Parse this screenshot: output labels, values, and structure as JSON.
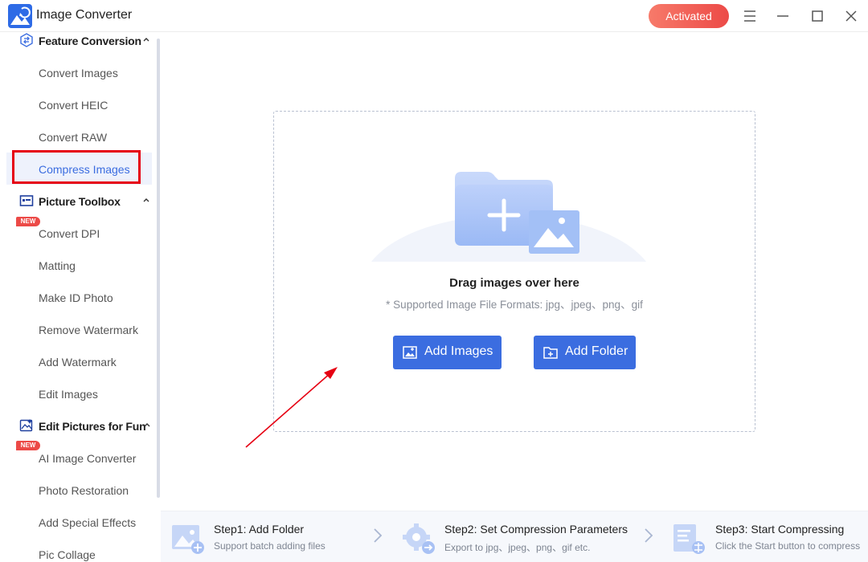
{
  "app": {
    "title": "Image Converter",
    "activated_label": "Activated"
  },
  "colors": {
    "accent": "#3b6de0",
    "activated_start": "#f77a6a",
    "activated_end": "#ec4a47",
    "highlight": "#e60012"
  },
  "sidebar": {
    "sections": [
      {
        "label": "Feature Conversion",
        "icon": "feature-conversion-icon",
        "items": [
          {
            "label": "Convert Images"
          },
          {
            "label": "Convert HEIC"
          },
          {
            "label": "Convert RAW"
          },
          {
            "label": "Compress Images",
            "active": true
          }
        ]
      },
      {
        "label": "Picture Toolbox",
        "icon": "picture-toolbox-icon",
        "items": [
          {
            "label": "Convert DPI",
            "badge": "NEW"
          },
          {
            "label": "Matting"
          },
          {
            "label": "Make ID Photo"
          },
          {
            "label": "Remove Watermark"
          },
          {
            "label": "Add Watermark"
          },
          {
            "label": "Edit Images"
          }
        ]
      },
      {
        "label": "Edit Pictures for Fun",
        "icon": "edit-pictures-icon",
        "items": [
          {
            "label": "AI Image Converter",
            "badge": "NEW"
          },
          {
            "label": "Photo Restoration"
          },
          {
            "label": "Add Special Effects"
          },
          {
            "label": "Pic Collage"
          }
        ]
      }
    ]
  },
  "dropzone": {
    "title": "Drag images over here",
    "formats": "* Supported Image File Formats: jpg、jpeg、png、gif",
    "add_images_label": "Add Images",
    "add_folder_label": "Add Folder"
  },
  "steps": [
    {
      "title": "Step1:  Add Folder",
      "desc": "Support batch adding files"
    },
    {
      "title": "Step2:  Set Compression Parameters",
      "desc": "Export to jpg、jpeg、png、gif etc."
    },
    {
      "title": "Step3:  Start Compressing",
      "desc": "Click the Start button to compress"
    }
  ]
}
